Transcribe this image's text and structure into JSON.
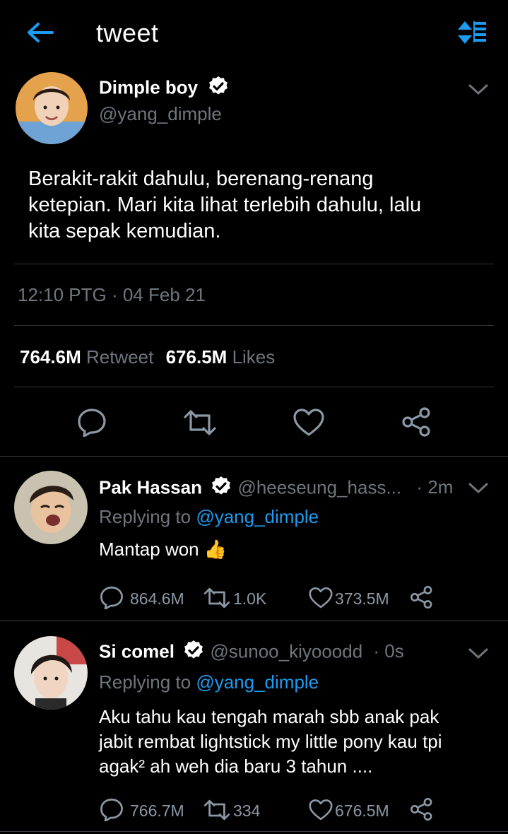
{
  "header": {
    "title": "tweet"
  },
  "tweet": {
    "author_name": "Dimple boy",
    "author_handle": "@yang_dimple",
    "text_line1": "Berakit-rakit dahulu, berenang-renang",
    "text_line2": "ketepian. Mari kita lihat terlebih dahulu, lalu",
    "text_line3": "kita sepak kemudian.",
    "timestamp": "12:10 PTG · 04 Feb 21",
    "retweet_count": "764.6M",
    "retweet_label": "Retweet",
    "likes_count": "676.5M",
    "likes_label": "Likes"
  },
  "replies": [
    {
      "name": "Pak Hassan",
      "handle": "@heeseung_hass...",
      "time": "· 2m",
      "replying_prefix": "Replying to",
      "replying_handle": "@yang_dimple",
      "text": "Mantap won",
      "emoji": "👍",
      "reply_count": "864.6M",
      "retweet_count": "1.0K",
      "like_count": "373.5M"
    },
    {
      "name": "Si comel",
      "handle": "@sunoo_kiyooodd",
      "time": "· 0s",
      "replying_prefix": "Replying to",
      "replying_handle": "@yang_dimple",
      "text_line1": "Aku tahu kau tengah marah sbb anak pak",
      "text_line2": "jabit rembat lightstick my little pony kau tpi",
      "text_line3": "agak² ah weh dia baru 3 tahun ....",
      "reply_count": "766.7M",
      "retweet_count": "334",
      "like_count": "676.5M"
    }
  ],
  "colors": {
    "accent": "#1d9bf0",
    "muted": "#6e767d",
    "divider": "#2f3336",
    "background": "#000000"
  },
  "icons": [
    "back-arrow-icon",
    "sort-icon",
    "verified-icon",
    "chevron-down-icon",
    "reply-icon",
    "retweet-icon",
    "like-icon",
    "share-icon"
  ]
}
